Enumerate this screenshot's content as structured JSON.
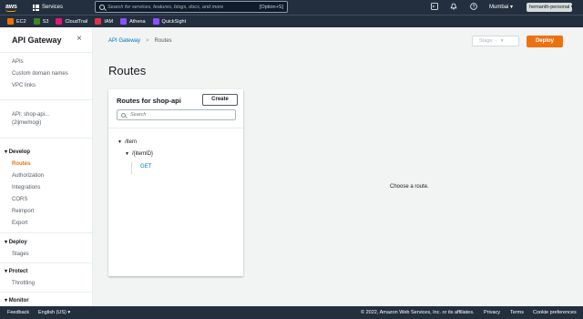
{
  "topnav": {
    "logo": "aws",
    "services_label": "Services",
    "search_placeholder": "Search for services, features, blogs, docs, and more",
    "search_shortcut": "[Option+S]",
    "region": "Mumbai ▾",
    "account": "hemanth-personal ▾",
    "icons": [
      "cloudshell-icon",
      "bell-icon",
      "help-icon"
    ]
  },
  "favorites": [
    {
      "label": "EC2",
      "color": "#ed7100"
    },
    {
      "label": "S3",
      "color": "#3f8624"
    },
    {
      "label": "CloudTrail",
      "color": "#e7157b"
    },
    {
      "label": "IAM",
      "color": "#dd344c"
    },
    {
      "label": "Athena",
      "color": "#8c4fff"
    },
    {
      "label": "QuickSight",
      "color": "#8c4fff"
    }
  ],
  "sidebar": {
    "title": "API Gateway",
    "top_links": [
      "APIs",
      "Custom domain names",
      "VPC links"
    ],
    "api_name_line1": "API: shop-api...",
    "api_name_line2": "(2ljmwmogi)",
    "sections": [
      {
        "title": "Develop",
        "items": [
          "Routes",
          "Authorization",
          "Integrations",
          "CORS",
          "Reimport",
          "Export"
        ]
      },
      {
        "title": "Deploy",
        "items": [
          "Stages"
        ]
      },
      {
        "title": "Protect",
        "items": [
          "Throttling"
        ]
      },
      {
        "title": "Monitor",
        "items": []
      }
    ],
    "active_item": "Routes"
  },
  "breadcrumb": {
    "root": "API Gateway",
    "separator": ">",
    "current": "Routes"
  },
  "stage_select": {
    "value": "Stage: -",
    "caret": "▾"
  },
  "deploy_label": "Deploy",
  "page_title": "Routes",
  "routes_panel": {
    "title": "Routes for shop-api",
    "create_label": "Create",
    "search_placeholder": "Search",
    "tree": {
      "root": "/item",
      "child": "/{itemID}",
      "method": "GET"
    }
  },
  "empty_message": "Choose a route.",
  "footer": {
    "feedback": "Feedback",
    "language": "English (US) ▾",
    "copyright": "© 2022, Amazon Web Services, Inc. or its affiliates.",
    "links": [
      "Privacy",
      "Terms",
      "Cookie preferences"
    ]
  }
}
